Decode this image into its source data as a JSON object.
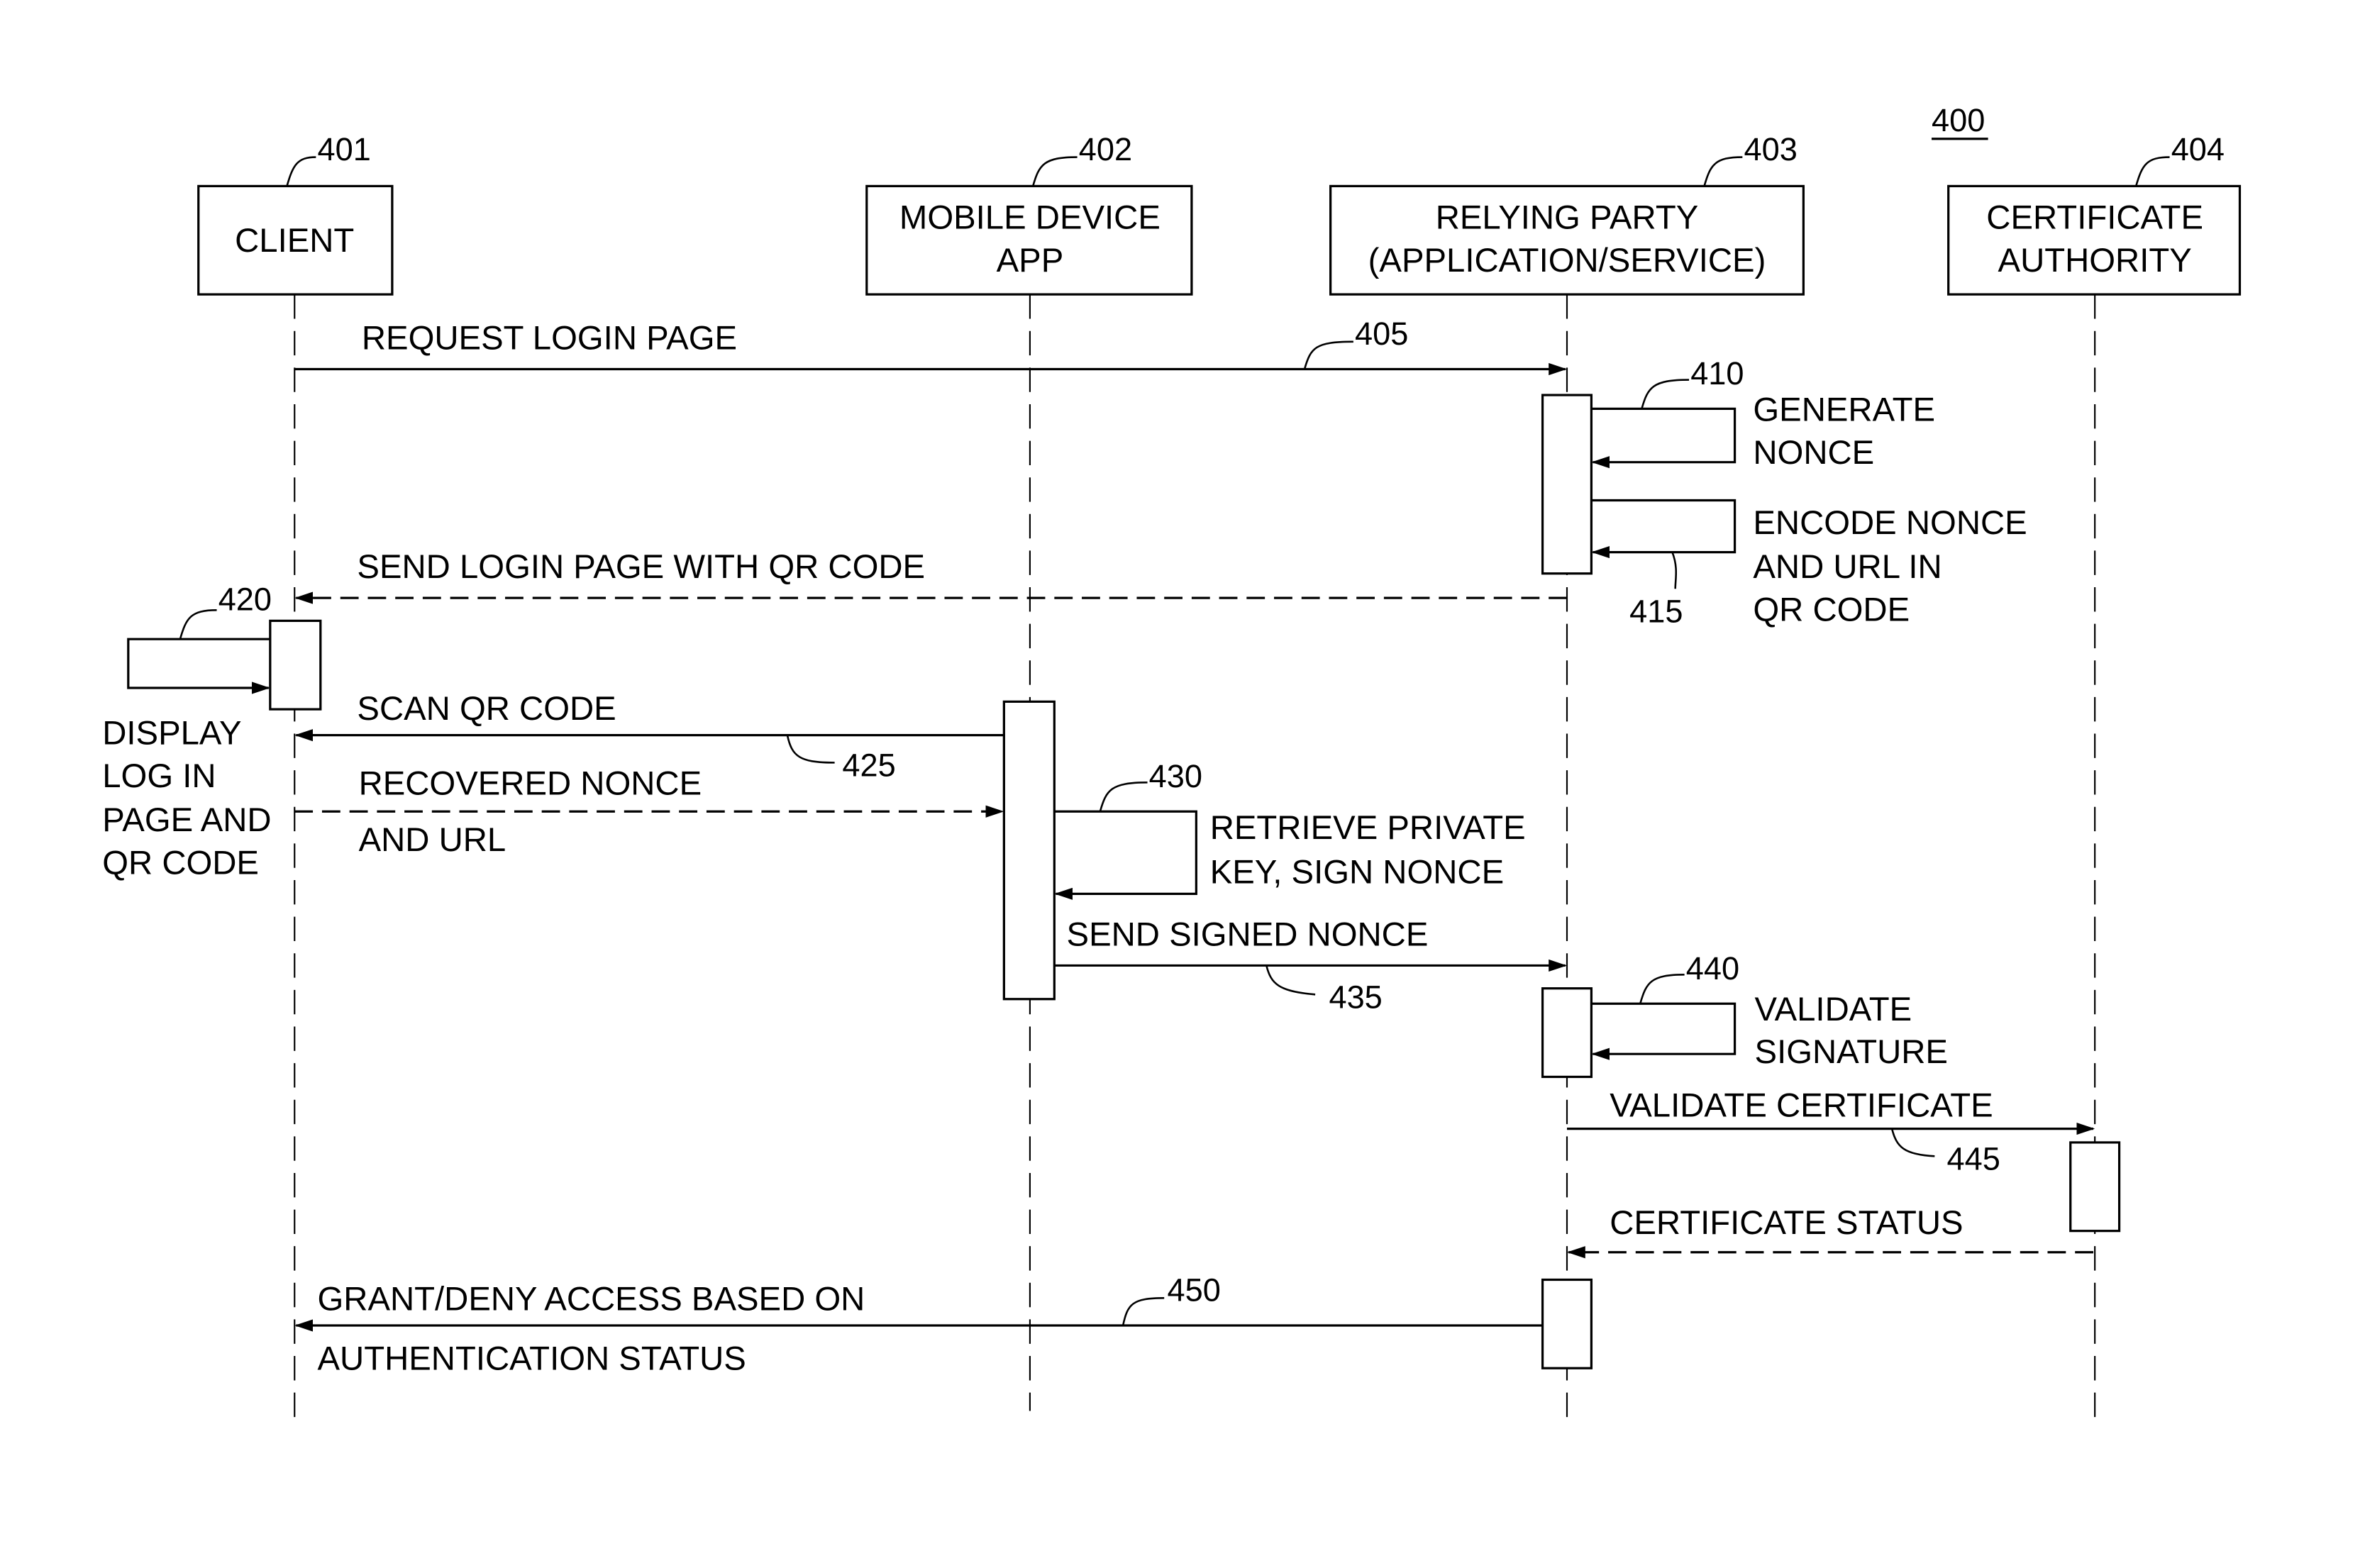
{
  "figure": {
    "number": "400",
    "participants": [
      {
        "ref": "401",
        "lines": [
          "CLIENT"
        ]
      },
      {
        "ref": "402",
        "lines": [
          "MOBILE DEVICE",
          "APP"
        ]
      },
      {
        "ref": "403",
        "lines": [
          "RELYING PARTY",
          "(APPLICATION/SERVICE)"
        ]
      },
      {
        "ref": "404",
        "lines": [
          "CERTIFICATE",
          "AUTHORITY"
        ]
      }
    ],
    "messages": [
      {
        "ref": "405",
        "from": "CLIENT",
        "to": "RELYING PARTY",
        "style": "solid",
        "lines": [
          "REQUEST LOGIN PAGE"
        ]
      },
      {
        "ref": "410",
        "from": "RELYING PARTY",
        "to": "RELYING PARTY",
        "style": "self",
        "lines": [
          "GENERATE",
          "NONCE"
        ]
      },
      {
        "ref": "415",
        "from": "RELYING PARTY",
        "to": "RELYING PARTY",
        "style": "self",
        "lines": [
          "ENCODE NONCE",
          "AND URL IN",
          "QR CODE"
        ]
      },
      {
        "ref": "",
        "from": "RELYING PARTY",
        "to": "CLIENT",
        "style": "dashed",
        "lines": [
          "SEND LOGIN PAGE WITH QR CODE"
        ]
      },
      {
        "ref": "420",
        "from": "CLIENT",
        "to": "CLIENT",
        "style": "self",
        "lines": [
          "DISPLAY",
          "LOG IN",
          "PAGE AND",
          "QR CODE"
        ]
      },
      {
        "ref": "425",
        "from": "MOBILE DEVICE APP",
        "to": "CLIENT",
        "style": "solid",
        "lines": [
          "SCAN QR CODE"
        ]
      },
      {
        "ref": "",
        "from": "CLIENT",
        "to": "MOBILE DEVICE APP",
        "style": "dashed",
        "lines": [
          "RECOVERED NONCE",
          "AND URL"
        ]
      },
      {
        "ref": "430",
        "from": "MOBILE DEVICE APP",
        "to": "MOBILE DEVICE APP",
        "style": "self",
        "lines": [
          "RETRIEVE PRIVATE",
          "KEY, SIGN NONCE"
        ]
      },
      {
        "ref": "435",
        "from": "MOBILE DEVICE APP",
        "to": "RELYING PARTY",
        "style": "solid",
        "lines": [
          "SEND SIGNED NONCE"
        ]
      },
      {
        "ref": "440",
        "from": "RELYING PARTY",
        "to": "RELYING PARTY",
        "style": "self",
        "lines": [
          "VALIDATE",
          "SIGNATURE"
        ]
      },
      {
        "ref": "445",
        "from": "RELYING PARTY",
        "to": "CERTIFICATE AUTHORITY",
        "style": "solid",
        "lines": [
          "VALIDATE CERTIFICATE"
        ]
      },
      {
        "ref": "",
        "from": "CERTIFICATE AUTHORITY",
        "to": "RELYING PARTY",
        "style": "dashed",
        "lines": [
          "CERTIFICATE STATUS"
        ]
      },
      {
        "ref": "450",
        "from": "RELYING PARTY",
        "to": "CLIENT",
        "style": "solid",
        "lines": [
          "GRANT/DENY ACCESS BASED ON",
          "AUTHENTICATION STATUS"
        ]
      }
    ]
  }
}
